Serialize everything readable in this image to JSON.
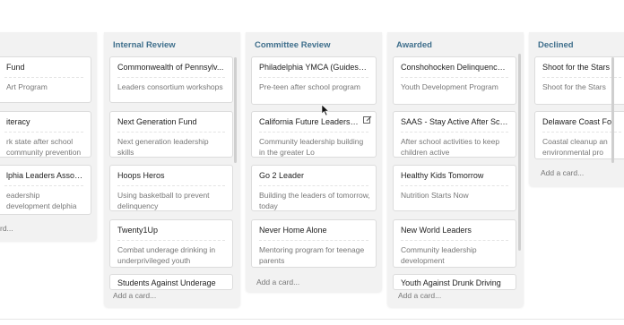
{
  "columns": [
    {
      "title": "",
      "cards": [
        {
          "title": "Fund",
          "desc": "Art Program"
        },
        {
          "title": "iteracy",
          "desc": "rk state after school community prevention"
        },
        {
          "title": "lphia Leaders Associa...",
          "desc": "eadership development delphia"
        }
      ],
      "add": "rd..."
    },
    {
      "title": "Internal Review",
      "cards": [
        {
          "title": "Commonwealth of Pennsylv...",
          "desc": "Leaders consortium workshops"
        },
        {
          "title": "Next Generation Fund",
          "desc": "Next generation leadership skills"
        },
        {
          "title": "Hoops Heros",
          "desc": "Using basketball to prevent delinquency"
        },
        {
          "title": "Twenty1Up",
          "desc": "Combat underage drinking in underprivileged youth"
        },
        {
          "title": "Students Against Underage",
          "desc": ""
        }
      ],
      "add": "Add a card..."
    },
    {
      "title": "Committee Review",
      "cards": [
        {
          "title": "Philadelphia YMCA (Guidesta...",
          "desc": "Pre-teen after school program"
        },
        {
          "title": "California Future Leaders o...",
          "desc": "Community leadership building in the greater Lo"
        },
        {
          "title": "Go 2 Leader",
          "desc": "Building the leaders of tomorrow, today"
        },
        {
          "title": "Never Home Alone",
          "desc": "Mentoring program for teenage parents"
        }
      ],
      "add": "Add a card..."
    },
    {
      "title": "Awarded",
      "cards": [
        {
          "title": "Conshohocken Delinquency ...",
          "desc": "Youth Development Program"
        },
        {
          "title": "SAAS - Stay Active After School",
          "desc": "After school activities to keep children active"
        },
        {
          "title": "Healthy Kids Tomorrow",
          "desc": "Nutrition Starts Now"
        },
        {
          "title": "New World Leaders",
          "desc": "Community leadership development"
        },
        {
          "title": "Youth Against Drunk Driving",
          "desc": ""
        }
      ],
      "add": "Add a card..."
    },
    {
      "title": "Declined",
      "cards": [
        {
          "title": "Shoot for the Stars",
          "desc": "Shoot for the Stars"
        },
        {
          "title": "Delaware Coast For",
          "desc": "Coastal cleanup an environmental pro"
        }
      ],
      "add": "Add a card..."
    }
  ],
  "icons": {
    "edit": "pencil-edit-icon",
    "cursor": "mouse-pointer-icon"
  },
  "colors": {
    "column_bg": "#f2f2f2",
    "column_title": "#3f6f8c"
  }
}
